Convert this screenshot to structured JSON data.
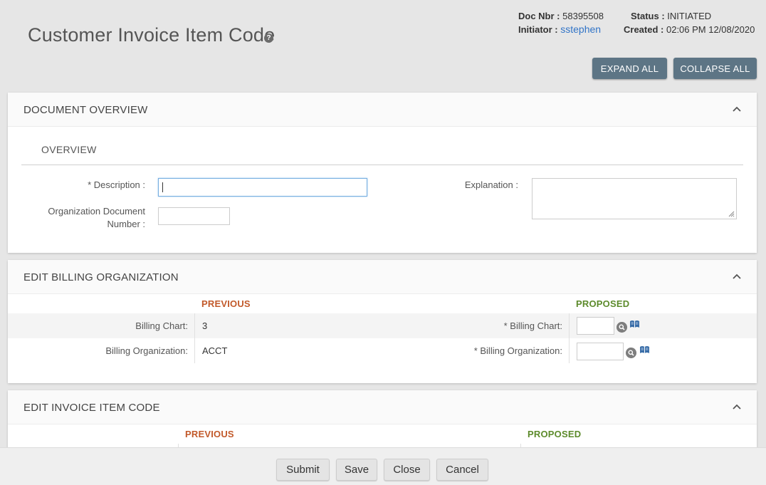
{
  "page": {
    "title": "Customer Invoice Item Code",
    "help_icon": "question-icon"
  },
  "header_meta": {
    "doc_nbr_label": "Doc Nbr :",
    "doc_nbr": "58395508",
    "initiator_label": "Initiator :",
    "initiator": "sstephen",
    "status_label": "Status :",
    "status": "INITIATED",
    "created_label": "Created :",
    "created": "02:06 PM 12/08/2020"
  },
  "actions": {
    "expand_all": "EXPAND ALL",
    "collapse_all": "COLLAPSE ALL"
  },
  "document_overview": {
    "title": "DOCUMENT OVERVIEW",
    "subsection": "OVERVIEW",
    "description_label": "* Description :",
    "description_value": "",
    "org_doc_label_line1": "Organization Document",
    "org_doc_label_line2": "Number :",
    "org_doc_value": "",
    "explanation_label": "Explanation :",
    "explanation_value": ""
  },
  "billing_org": {
    "title": "EDIT BILLING ORGANIZATION",
    "previous_label": "PREVIOUS",
    "proposed_label": "PROPOSED",
    "rows": [
      {
        "label": "Billing Chart:",
        "previous": "3",
        "proposed_label": "* Billing Chart:",
        "proposed_value": ""
      },
      {
        "label": "Billing Organization:",
        "previous": "ACCT",
        "proposed_label": "* Billing Organization:",
        "proposed_value": ""
      }
    ]
  },
  "invoice_item": {
    "title": "EDIT INVOICE ITEM CODE",
    "previous_label": "PREVIOUS",
    "proposed_label": "PROPOSED"
  },
  "footer": {
    "submit": "Submit",
    "save": "Save",
    "close": "Close",
    "cancel": "Cancel"
  },
  "colors": {
    "previous": "#c25a2b",
    "proposed": "#5d8b2c",
    "primary_button": "#5d7585",
    "link": "#3174c7"
  }
}
